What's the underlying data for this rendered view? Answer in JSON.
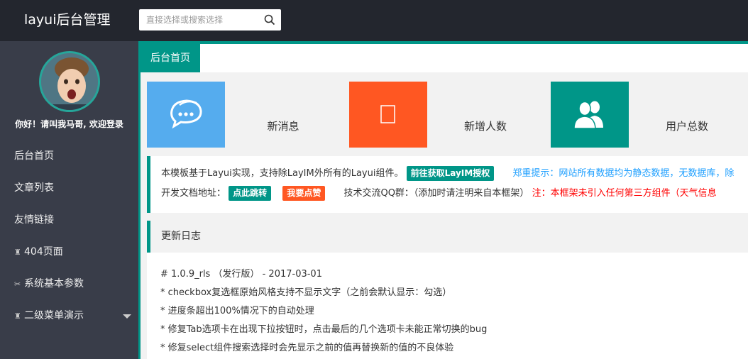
{
  "header": {
    "logo": "layui后台管理",
    "search_placeholder": "直接选择或搜索选择"
  },
  "sidebar": {
    "greeting": "你好！请叫我马哥, 欢迎登录",
    "items": [
      {
        "label": "后台首页",
        "icon": ""
      },
      {
        "label": "文章列表",
        "icon": ""
      },
      {
        "label": "友情链接",
        "icon": ""
      },
      {
        "label": "404页面",
        "icon": "♜"
      },
      {
        "label": "系统基本参数",
        "icon": "✂"
      },
      {
        "label": "二级菜单演示",
        "icon": "♜"
      }
    ]
  },
  "tabs": [
    {
      "label": "后台首页"
    }
  ],
  "cards": [
    {
      "label": "新消息",
      "color": "#55acee",
      "icon": "chat-icon"
    },
    {
      "label": "新增人数",
      "color": "#ff5722",
      "icon": "placeholder-box-icon"
    },
    {
      "label": "用户总数",
      "color": "#009688",
      "icon": "users-icon"
    }
  ],
  "notice": {
    "line1_text": "本模板基于Layui实现，支持除LayIM外所有的Layui组件。",
    "line1_badge": "前往获取LayIM授权",
    "line1_tip": "郑重提示：网站所有数据均为静态数据，无数据库，除",
    "line2_label": "开发文档地址：",
    "line2_badge1": "点此跳转",
    "line2_badge2": "我要点赞",
    "line2_qq": "技术交流QQ群：（添加时请注明来自本框架）",
    "line2_note": "注：本框架未引入任何第三方组件（天气信息"
  },
  "changelog": {
    "title": "更新日志",
    "lines": [
      "# 1.0.9_rls （发行版） - 2017-03-01",
      "* checkbox复选框原始风格支持不显示文字（之前会默认显示：勾选）",
      "* 进度条超出100%情况下的自动处理",
      "* 修复Tab选项卡在出现下拉按钮时，点击最后的几个选项卡未能正常切换的bug",
      "* 修复select组件搜索选择时会先显示之前的值再替换新的值的不良体验"
    ]
  }
}
